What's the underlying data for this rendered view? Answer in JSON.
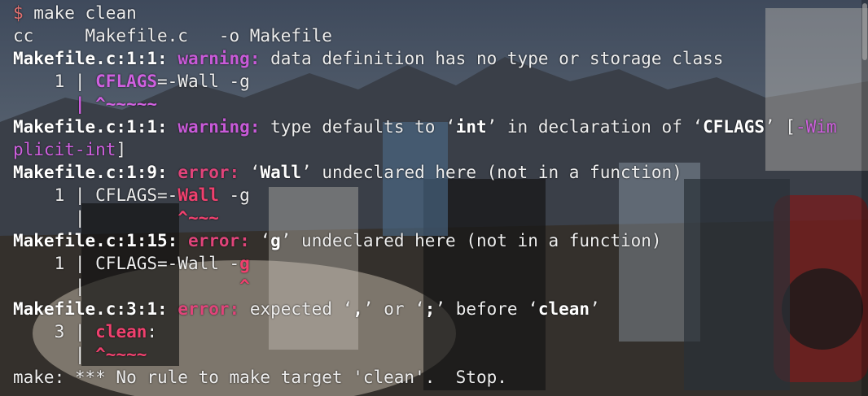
{
  "prompt": "$",
  "command": " make clean",
  "lines": {
    "cc_line": "cc     Makefile.c   -o Makefile",
    "w1_loc": "Makefile.c:1:1:",
    "w1_kind": "warning:",
    "w1_msg": " data definition has no type or storage class",
    "w1_src_num": "    1 | ",
    "w1_src_hl": "CFLAGS",
    "w1_src_rest": "=-Wall -g",
    "w1_caret": "      | ^~~~~~",
    "w2_loc": "Makefile.c:1:1:",
    "w2_kind": "warning:",
    "w2_msg_a": " type defaults to ‘",
    "w2_msg_int": "int",
    "w2_msg_b": "’ in declaration of ‘",
    "w2_msg_cflags": "CFLAGS",
    "w2_msg_c": "’ [",
    "w2_flag_a": "-Wim",
    "w2_flag_b": "plicit-int",
    "w2_close": "]",
    "e1_loc": "Makefile.c:1:9:",
    "e1_kind": "error:",
    "e1_msg_a": " ‘",
    "e1_msg_wall": "Wall",
    "e1_msg_b": "’ undeclared here (not in a function)",
    "e1_src_num": "    1 | ",
    "e1_src_a": "CFLAGS=-",
    "e1_src_hl": "Wall",
    "e1_src_b": " -g",
    "e1_caret_a": "      |         ",
    "e1_caret_b": "^~~~",
    "e2_loc": "Makefile.c:1:15:",
    "e2_kind": "error:",
    "e2_msg_a": " ‘",
    "e2_msg_g": "g",
    "e2_msg_b": "’ undeclared here (not in a function)",
    "e2_src_num": "    1 | ",
    "e2_src_a": "CFLAGS=-Wall -",
    "e2_src_hl": "g",
    "e2_caret_a": "      |               ",
    "e2_caret_b": "^",
    "e3_loc": "Makefile.c:3:1:",
    "e3_kind": "error:",
    "e3_msg_a": " expected ‘",
    "e3_comma": ",",
    "e3_msg_b": "’ or ‘",
    "e3_semi": ";",
    "e3_msg_c": "’ before ‘",
    "e3_clean": "clean",
    "e3_msg_d": "’",
    "e3_src_num": "    3 | ",
    "e3_src_hl": "clean",
    "e3_src_rest": ":",
    "e3_caret_a": "      | ",
    "e3_caret_b": "^~~~~",
    "make_line": "make: *** No rule to make target 'clean'.  Stop."
  },
  "colors": {
    "warning": "#c85ad8",
    "error": "#e0447a",
    "text": "#eeeeee"
  }
}
